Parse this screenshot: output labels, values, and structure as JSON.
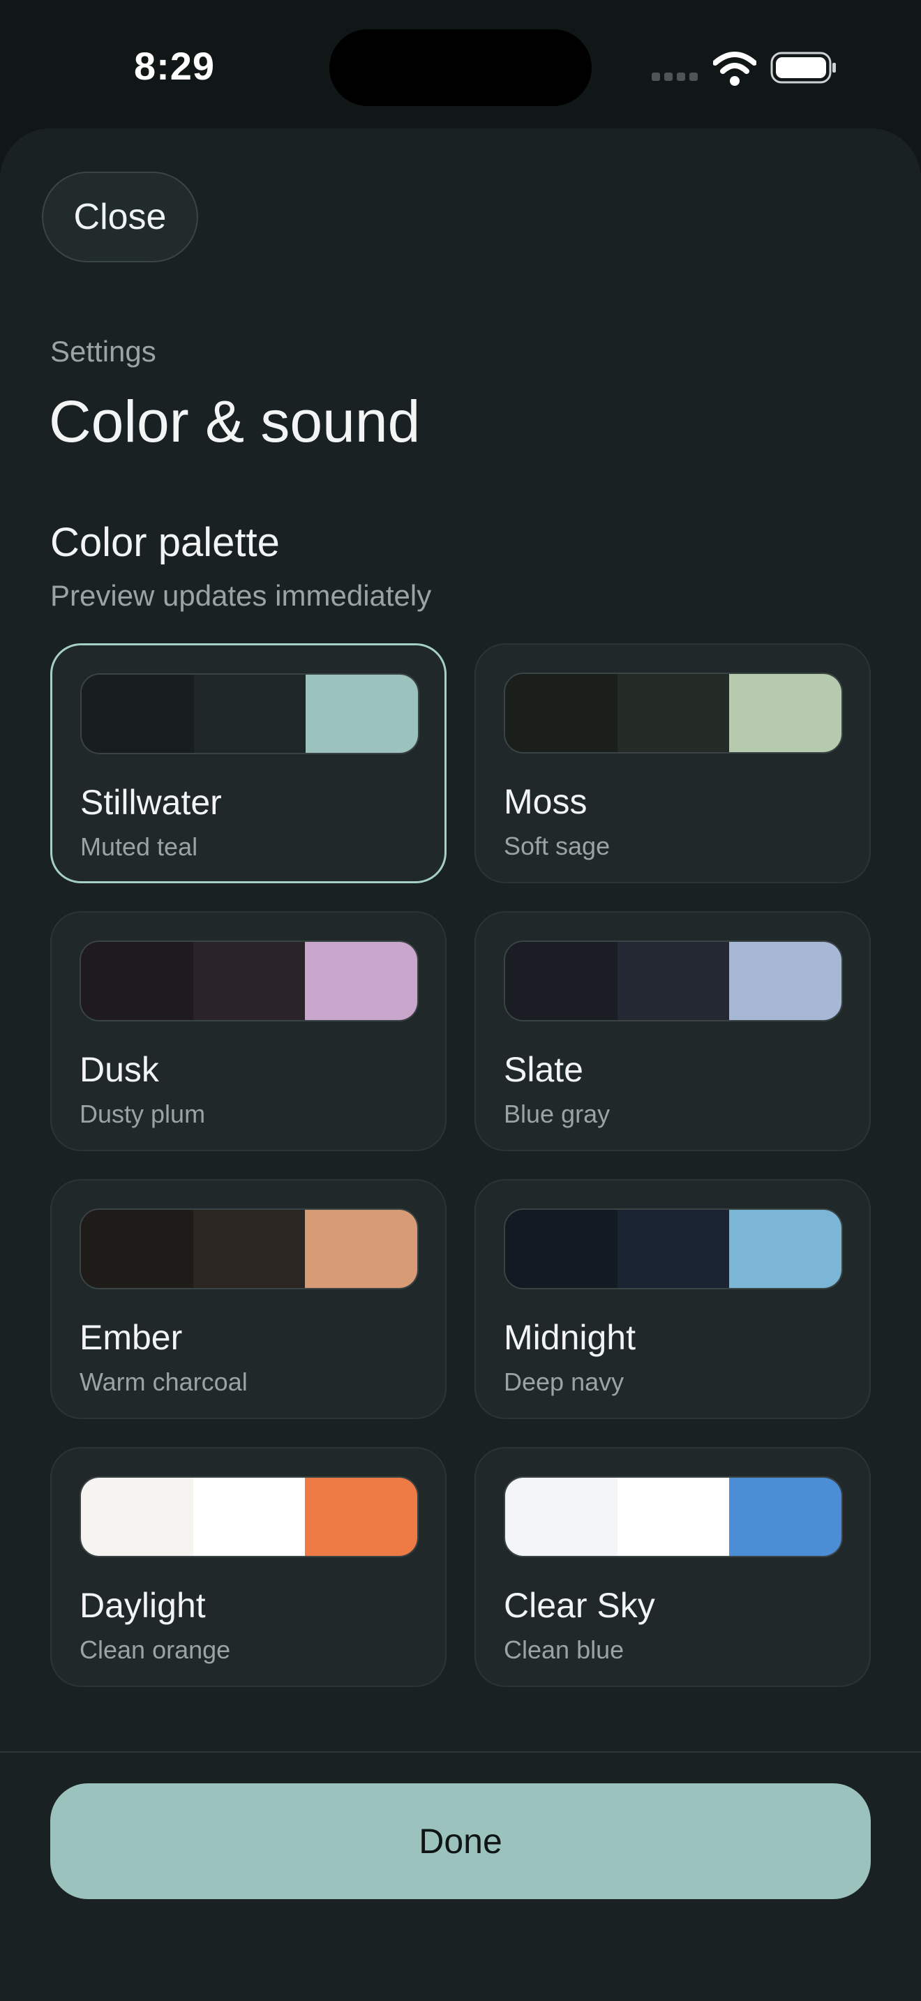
{
  "status_bar": {
    "time": "8:29",
    "icons": [
      "signal-icon",
      "wifi-icon",
      "battery-icon"
    ]
  },
  "header": {
    "close_label": "Close",
    "eyebrow": "Settings",
    "title": "Color & sound"
  },
  "palette_section": {
    "title": "Color palette",
    "subtitle": "Preview updates immediately",
    "selected": "Stillwater",
    "palettes": [
      {
        "name": "Stillwater",
        "description": "Muted teal",
        "colors": [
          "#181e1f",
          "#1e2627",
          "#9cc2bd"
        ]
      },
      {
        "name": "Moss",
        "description": "Soft sage",
        "colors": [
          "#1a1f1b",
          "#242a25",
          "#b6caad"
        ]
      },
      {
        "name": "Dusk",
        "description": "Dusty plum",
        "colors": [
          "#1e1a1f",
          "#2a2429",
          "#c9a6cc"
        ]
      },
      {
        "name": "Slate",
        "description": "Blue gray",
        "colors": [
          "#1a1d23",
          "#242833",
          "#a6b8d6"
        ]
      },
      {
        "name": "Ember",
        "description": "Warm charcoal",
        "colors": [
          "#1f1b19",
          "#2b2622",
          "#d79b76"
        ]
      },
      {
        "name": "Midnight",
        "description": "Deep navy",
        "colors": [
          "#121a23",
          "#1a2433",
          "#7bb6d7"
        ]
      },
      {
        "name": "Daylight",
        "description": "Clean orange",
        "colors": [
          "#f5f4f0",
          "#ffffff",
          "#ee7a45"
        ]
      },
      {
        "name": "Clear Sky",
        "description": "Clean blue",
        "colors": [
          "#f3f5f7",
          "#ffffff",
          "#4b8ed6"
        ]
      }
    ]
  },
  "footer": {
    "done_label": "Done"
  },
  "colors": {
    "background": "#111617",
    "sheet": "#1a2122",
    "accent": "#9cc2bd",
    "selected_border": "#a6cfc6"
  }
}
